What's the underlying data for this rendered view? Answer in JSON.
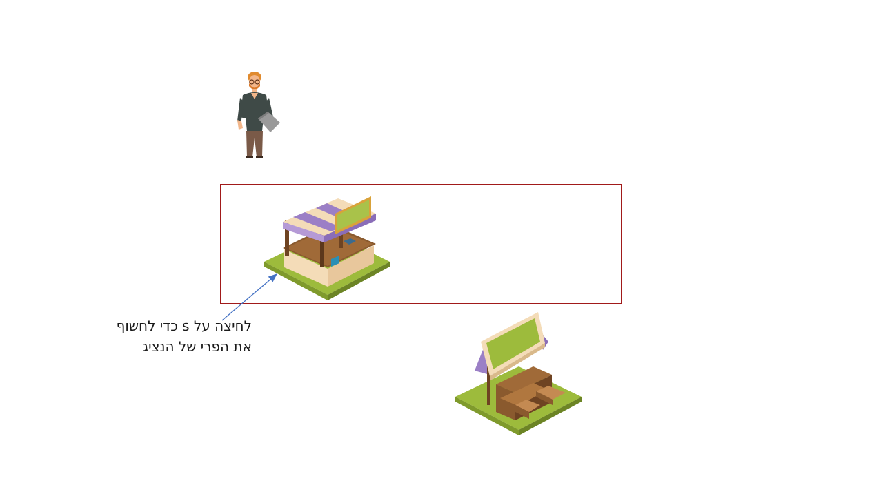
{
  "hint": {
    "line1": "לחיצה על s כדי לחשוף",
    "line2": "את הפרי של הנציג"
  },
  "colors": {
    "highlight_border": "#a11a1a",
    "arrow": "#4472c4",
    "grass": "#9dbb3c",
    "awning_purple": "#9b7fc6",
    "wood": "#7a4a22"
  },
  "icons": {
    "character": "man-with-laptop-icon",
    "stall_1": "market-stall-awning-icon",
    "stall_2": "market-stall-sign-icon"
  }
}
